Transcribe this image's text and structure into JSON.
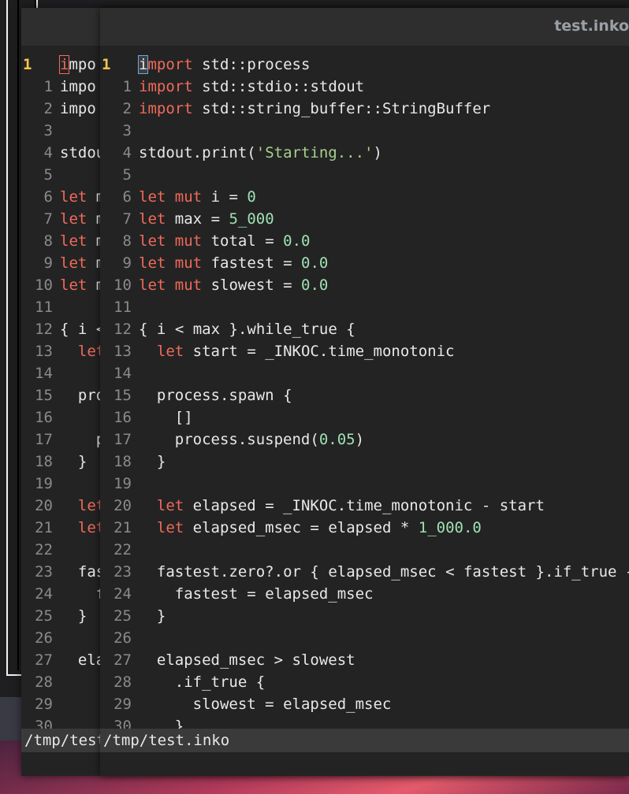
{
  "window": {
    "title": "test.inko"
  },
  "status": {
    "path": "/tmp/test.inko"
  },
  "colors": {
    "keyword": "#f06a5a",
    "number": "#9fe0b4",
    "string": "#a8d08d",
    "current_line_number": "#f3c74c",
    "cursor_outline": "#6fa8dc"
  },
  "back_editor": {
    "lines": [
      {
        "ln": "1",
        "text": "impo",
        "cur": true
      },
      {
        "ln": "1",
        "text": "impo"
      },
      {
        "ln": "2",
        "text": "impo"
      },
      {
        "ln": "3",
        "text": ""
      },
      {
        "ln": "4",
        "text": "stdou"
      },
      {
        "ln": "5",
        "text": ""
      },
      {
        "ln": "6",
        "text": "let m"
      },
      {
        "ln": "7",
        "text": "let m"
      },
      {
        "ln": "8",
        "text": "let m"
      },
      {
        "ln": "9",
        "text": "let m"
      },
      {
        "ln": "10",
        "text": "let m"
      },
      {
        "ln": "11",
        "text": ""
      },
      {
        "ln": "12",
        "text": "{ i <"
      },
      {
        "ln": "13",
        "text": "  let"
      },
      {
        "ln": "14",
        "text": ""
      },
      {
        "ln": "15",
        "text": "  pro"
      },
      {
        "ln": "16",
        "text": ""
      },
      {
        "ln": "17",
        "text": "    p"
      },
      {
        "ln": "18",
        "text": "  }"
      },
      {
        "ln": "19",
        "text": ""
      },
      {
        "ln": "20",
        "text": "  let"
      },
      {
        "ln": "21",
        "text": "  let"
      },
      {
        "ln": "22",
        "text": ""
      },
      {
        "ln": "23",
        "text": "  fas"
      },
      {
        "ln": "24",
        "text": "    f"
      },
      {
        "ln": "25",
        "text": "  }"
      },
      {
        "ln": "26",
        "text": ""
      },
      {
        "ln": "27",
        "text": "  ela"
      },
      {
        "ln": "28",
        "text": ""
      },
      {
        "ln": "29",
        "text": ""
      },
      {
        "ln": "30",
        "text": "     "
      }
    ]
  },
  "editor": {
    "lines": [
      {
        "ln": "1",
        "text": "import std::process",
        "cur": true
      },
      {
        "ln": "1",
        "text": "import std::stdio::stdout"
      },
      {
        "ln": "2",
        "text": "import std::string_buffer::StringBuffer"
      },
      {
        "ln": "3",
        "text": ""
      },
      {
        "ln": "4",
        "text": "stdout.print('Starting...')"
      },
      {
        "ln": "5",
        "text": ""
      },
      {
        "ln": "6",
        "text": "let mut i = 0"
      },
      {
        "ln": "7",
        "text": "let max = 5_000"
      },
      {
        "ln": "8",
        "text": "let mut total = 0.0"
      },
      {
        "ln": "9",
        "text": "let mut fastest = 0.0"
      },
      {
        "ln": "10",
        "text": "let mut slowest = 0.0"
      },
      {
        "ln": "11",
        "text": ""
      },
      {
        "ln": "12",
        "text": "{ i < max }.while_true {"
      },
      {
        "ln": "13",
        "text": "  let start = _INKOC.time_monotonic"
      },
      {
        "ln": "14",
        "text": ""
      },
      {
        "ln": "15",
        "text": "  process.spawn {"
      },
      {
        "ln": "16",
        "text": "    []"
      },
      {
        "ln": "17",
        "text": "    process.suspend(0.05)"
      },
      {
        "ln": "18",
        "text": "  }"
      },
      {
        "ln": "19",
        "text": ""
      },
      {
        "ln": "20",
        "text": "  let elapsed = _INKOC.time_monotonic - start"
      },
      {
        "ln": "21",
        "text": "  let elapsed_msec = elapsed * 1_000.0"
      },
      {
        "ln": "22",
        "text": ""
      },
      {
        "ln": "23",
        "text": "  fastest.zero?.or { elapsed_msec < fastest }.if_true {"
      },
      {
        "ln": "24",
        "text": "    fastest = elapsed_msec"
      },
      {
        "ln": "25",
        "text": "  }"
      },
      {
        "ln": "26",
        "text": ""
      },
      {
        "ln": "27",
        "text": "  elapsed_msec > slowest"
      },
      {
        "ln": "28",
        "text": "    .if_true {"
      },
      {
        "ln": "29",
        "text": "      slowest = elapsed_msec"
      },
      {
        "ln": "30",
        "text": "    }"
      }
    ]
  }
}
